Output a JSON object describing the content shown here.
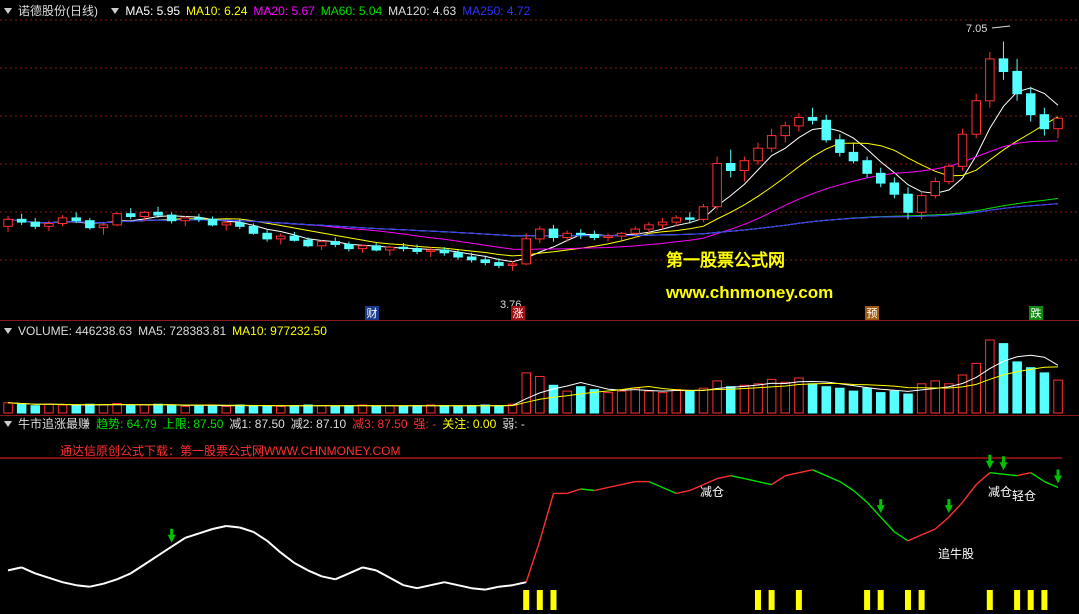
{
  "header": {
    "stock": "诺德股份(日线)",
    "ma": [
      {
        "label": "MA5: 5.95",
        "color": "#ffffff"
      },
      {
        "label": "MA10: 6.24",
        "color": "#ffff00"
      },
      {
        "label": "MA20: 5.67",
        "color": "#ff00ff"
      },
      {
        "label": "MA60: 5.04",
        "color": "#00e000"
      },
      {
        "label": "MA120: 4.63",
        "color": "#dddddd"
      },
      {
        "label": "MA250: 4.72",
        "color": "#3030ff"
      }
    ]
  },
  "volume_header": {
    "items": [
      {
        "label": "VOLUME: 446238.63",
        "color": "#dddddd"
      },
      {
        "label": "MA5: 728383.81",
        "color": "#dddddd"
      },
      {
        "label": "MA10: 977232.50",
        "color": "#ffff00"
      }
    ]
  },
  "indicator_header": {
    "items": [
      {
        "label": "牛市追涨最赚",
        "color": "#dddddd"
      },
      {
        "label": "趋势: 64.79",
        "color": "#00e000"
      },
      {
        "label": "上限: 87.50",
        "color": "#00e000"
      },
      {
        "label": "减1: 87.50",
        "color": "#dddddd"
      },
      {
        "label": "减2: 87.10",
        "color": "#dddddd"
      },
      {
        "label": "减3: 87.50",
        "color": "#ff3030"
      },
      {
        "label": "强: -",
        "color": "#ff3030"
      },
      {
        "label": "关注: 0.00",
        "color": "#ffff00"
      },
      {
        "label": "弱: -",
        "color": "#dddddd"
      }
    ]
  },
  "indicator_note": "通达信原创公式下载：第一股票公式网WWW.CHNMONEY.COM",
  "watermark": {
    "line1": "第一股票公式网",
    "line2": "www.chnmoney.com"
  },
  "price_labels": {
    "high": "7.05",
    "low": "3.76"
  },
  "event_markers": [
    {
      "text": "财",
      "bg": "#1a3a8a"
    },
    {
      "text": "涨",
      "bg": "#a01010"
    },
    {
      "text": "预",
      "bg": "#a05a10"
    },
    {
      "text": "跌",
      "bg": "#108a10"
    }
  ],
  "signal_labels": [
    "减仓",
    "减仓",
    "轻仓",
    "追牛股"
  ],
  "colors": {
    "up": "#ff3030",
    "down": "#54ffff",
    "grid": "#8a1a1a",
    "white": "#ffffff",
    "yellow": "#ffff00",
    "magenta": "#ff00ff",
    "green": "#00e000",
    "gray": "#dddddd",
    "blue": "#3030ff",
    "arrow": "#00c000"
  },
  "chart_data": {
    "type": "candlestick",
    "x_unit": "trading day index",
    "price_range": [
      3.2,
      7.3
    ],
    "candles_ohlc": [
      [
        4.4,
        4.55,
        4.32,
        4.5
      ],
      [
        4.5,
        4.58,
        4.42,
        4.46
      ],
      [
        4.46,
        4.52,
        4.36,
        4.4
      ],
      [
        4.4,
        4.48,
        4.33,
        4.44
      ],
      [
        4.44,
        4.56,
        4.4,
        4.52
      ],
      [
        4.52,
        4.6,
        4.45,
        4.48
      ],
      [
        4.48,
        4.52,
        4.35,
        4.38
      ],
      [
        4.38,
        4.45,
        4.28,
        4.42
      ],
      [
        4.42,
        4.6,
        4.4,
        4.58
      ],
      [
        4.58,
        4.66,
        4.5,
        4.54
      ],
      [
        4.54,
        4.62,
        4.48,
        4.6
      ],
      [
        4.6,
        4.68,
        4.52,
        4.56
      ],
      [
        4.56,
        4.6,
        4.44,
        4.48
      ],
      [
        4.48,
        4.55,
        4.4,
        4.52
      ],
      [
        4.52,
        4.58,
        4.46,
        4.5
      ],
      [
        4.5,
        4.54,
        4.4,
        4.42
      ],
      [
        4.42,
        4.48,
        4.34,
        4.45
      ],
      [
        4.45,
        4.5,
        4.36,
        4.4
      ],
      [
        4.4,
        4.44,
        4.28,
        4.3
      ],
      [
        4.3,
        4.36,
        4.18,
        4.22
      ],
      [
        4.22,
        4.3,
        4.14,
        4.26
      ],
      [
        4.26,
        4.32,
        4.18,
        4.2
      ],
      [
        4.2,
        4.24,
        4.1,
        4.12
      ],
      [
        4.12,
        4.2,
        4.06,
        4.18
      ],
      [
        4.18,
        4.24,
        4.1,
        4.14
      ],
      [
        4.14,
        4.18,
        4.04,
        4.08
      ],
      [
        4.08,
        4.14,
        4.02,
        4.12
      ],
      [
        4.12,
        4.16,
        4.04,
        4.06
      ],
      [
        4.06,
        4.12,
        3.98,
        4.1
      ],
      [
        4.1,
        4.16,
        4.04,
        4.08
      ],
      [
        4.08,
        4.14,
        4.0,
        4.04
      ],
      [
        4.04,
        4.1,
        3.96,
        4.06
      ],
      [
        4.06,
        4.1,
        3.98,
        4.02
      ],
      [
        4.02,
        4.06,
        3.92,
        3.96
      ],
      [
        3.96,
        4.02,
        3.88,
        3.92
      ],
      [
        3.92,
        3.98,
        3.84,
        3.88
      ],
      [
        3.88,
        3.94,
        3.8,
        3.84
      ],
      [
        3.84,
        3.9,
        3.76,
        3.86
      ],
      [
        3.86,
        4.3,
        3.84,
        4.22
      ],
      [
        4.22,
        4.4,
        4.16,
        4.36
      ],
      [
        4.36,
        4.42,
        4.18,
        4.24
      ],
      [
        4.24,
        4.34,
        4.18,
        4.3
      ],
      [
        4.3,
        4.36,
        4.22,
        4.28
      ],
      [
        4.28,
        4.34,
        4.2,
        4.24
      ],
      [
        4.24,
        4.3,
        4.18,
        4.26
      ],
      [
        4.26,
        4.32,
        4.2,
        4.3
      ],
      [
        4.3,
        4.4,
        4.24,
        4.36
      ],
      [
        4.36,
        4.46,
        4.3,
        4.42
      ],
      [
        4.42,
        4.52,
        4.36,
        4.46
      ],
      [
        4.46,
        4.56,
        4.4,
        4.52
      ],
      [
        4.52,
        4.6,
        4.44,
        4.5
      ],
      [
        4.5,
        4.72,
        4.46,
        4.68
      ],
      [
        4.68,
        5.4,
        4.64,
        5.3
      ],
      [
        5.3,
        5.5,
        5.1,
        5.2
      ],
      [
        5.2,
        5.4,
        5.04,
        5.34
      ],
      [
        5.34,
        5.6,
        5.28,
        5.52
      ],
      [
        5.52,
        5.8,
        5.46,
        5.7
      ],
      [
        5.7,
        5.9,
        5.6,
        5.84
      ],
      [
        5.84,
        6.02,
        5.76,
        5.96
      ],
      [
        5.96,
        6.1,
        5.86,
        5.92
      ],
      [
        5.92,
        6.0,
        5.6,
        5.64
      ],
      [
        5.64,
        5.72,
        5.4,
        5.46
      ],
      [
        5.46,
        5.6,
        5.3,
        5.34
      ],
      [
        5.34,
        5.4,
        5.1,
        5.16
      ],
      [
        5.16,
        5.24,
        4.96,
        5.02
      ],
      [
        5.02,
        5.1,
        4.8,
        4.86
      ],
      [
        4.86,
        4.96,
        4.5,
        4.6
      ],
      [
        4.6,
        4.9,
        4.5,
        4.84
      ],
      [
        4.84,
        5.1,
        4.8,
        5.04
      ],
      [
        5.04,
        5.3,
        5.0,
        5.26
      ],
      [
        5.26,
        5.8,
        5.2,
        5.72
      ],
      [
        5.72,
        6.3,
        5.66,
        6.2
      ],
      [
        6.2,
        6.9,
        6.1,
        6.8
      ],
      [
        6.8,
        7.05,
        6.5,
        6.62
      ],
      [
        6.62,
        6.8,
        6.2,
        6.3
      ],
      [
        6.3,
        6.4,
        5.9,
        6.0
      ],
      [
        6.0,
        6.1,
        5.7,
        5.8
      ],
      [
        5.8,
        5.96,
        5.66,
        5.95
      ]
    ],
    "candle_direction_note": "close >= open drawn red hollow (up), else cyan filled (down)",
    "ma_latest": {
      "MA5": 5.95,
      "MA10": 6.24,
      "MA20": 5.67,
      "MA60": 5.04,
      "MA120": 4.63,
      "MA250": 4.72
    },
    "volume_latest": 446238.63,
    "volume_ma5": 728383.81,
    "volume_ma10": 977232.5,
    "volume_bars": [
      0.14,
      0.12,
      0.1,
      0.12,
      0.11,
      0.1,
      0.12,
      0.11,
      0.13,
      0.1,
      0.11,
      0.12,
      0.1,
      0.09,
      0.11,
      0.1,
      0.09,
      0.11,
      0.1,
      0.1,
      0.09,
      0.1,
      0.11,
      0.1,
      0.09,
      0.1,
      0.11,
      0.09,
      0.1,
      0.09,
      0.1,
      0.11,
      0.1,
      0.09,
      0.1,
      0.11,
      0.1,
      0.12,
      0.55,
      0.5,
      0.38,
      0.3,
      0.36,
      0.32,
      0.28,
      0.3,
      0.34,
      0.3,
      0.28,
      0.32,
      0.3,
      0.34,
      0.44,
      0.36,
      0.38,
      0.4,
      0.46,
      0.42,
      0.48,
      0.4,
      0.36,
      0.34,
      0.3,
      0.34,
      0.28,
      0.3,
      0.26,
      0.4,
      0.44,
      0.4,
      0.52,
      0.68,
      1.0,
      0.95,
      0.7,
      0.62,
      0.55,
      0.45
    ],
    "indicator": {
      "趋势": 64.79,
      "上限": 87.5,
      "减1": 87.5,
      "减2": 87.1,
      "减3": 87.5,
      "关注": 0.0,
      "line": [
        20,
        22,
        18,
        15,
        12,
        10,
        9,
        11,
        14,
        18,
        24,
        30,
        36,
        42,
        45,
        48,
        50,
        49,
        46,
        40,
        32,
        25,
        20,
        16,
        14,
        18,
        22,
        20,
        15,
        10,
        8,
        10,
        12,
        10,
        8,
        7,
        9,
        10,
        12,
        40,
        72,
        72,
        75,
        74,
        76,
        78,
        80,
        80,
        76,
        72,
        74,
        78,
        82,
        84,
        82,
        80,
        78,
        84,
        86,
        88,
        84,
        80,
        74,
        66,
        56,
        46,
        40,
        44,
        48,
        56,
        66,
        78,
        86,
        85,
        84,
        86,
        80,
        76
      ]
    }
  }
}
